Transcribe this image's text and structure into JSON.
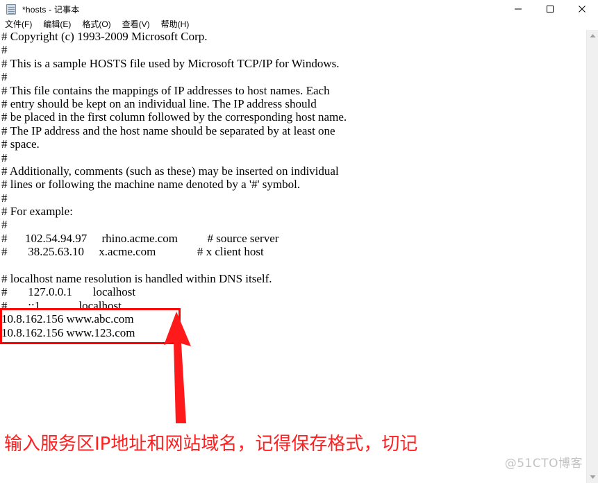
{
  "window": {
    "title": "*hosts - 记事本",
    "icon": "notepad-icon",
    "controls": {
      "minimize": "—",
      "maximize": "□",
      "close": "✕"
    }
  },
  "menubar": {
    "items": [
      {
        "label": "文件(F)",
        "text": "文件",
        "accel": "F"
      },
      {
        "label": "编辑(E)",
        "text": "编辑",
        "accel": "E"
      },
      {
        "label": "格式(O)",
        "text": "格式",
        "accel": "O"
      },
      {
        "label": "查看(V)",
        "text": "查看",
        "accel": "V"
      },
      {
        "label": "帮助(H)",
        "text": "帮助",
        "accel": "H"
      }
    ]
  },
  "editor": {
    "lines": [
      "# Copyright (c) 1993-2009 Microsoft Corp.",
      "#",
      "# This is a sample HOSTS file used by Microsoft TCP/IP for Windows.",
      "#",
      "# This file contains the mappings of IP addresses to host names. Each",
      "# entry should be kept on an individual line. The IP address should",
      "# be placed in the first column followed by the corresponding host name.",
      "# The IP address and the host name should be separated by at least one",
      "# space.",
      "#",
      "# Additionally, comments (such as these) may be inserted on individual",
      "# lines or following the machine name denoted by a '#' symbol.",
      "#",
      "# For example:",
      "#",
      "#      102.54.94.97     rhino.acme.com          # source server",
      "#       38.25.63.10     x.acme.com              # x client host",
      "",
      "# localhost name resolution is handled within DNS itself.",
      "#       127.0.0.1       localhost",
      "#       ::1             localhost",
      "10.8.162.156 www.abc.com",
      "10.8.162.156 www.123.com"
    ]
  },
  "annotations": {
    "highlight_box_label": "new-host-entries-highlight",
    "arrow_label": "callout-arrow",
    "note": "输入服务区IP地址和网站域名，记得保存格式，切记"
  },
  "watermark": {
    "text": "@51CTO博客"
  },
  "colors": {
    "annotation_red": "#fe0000",
    "note_red": "#fe2020",
    "watermark_gray": "#c2c2c2",
    "text_black": "#000000",
    "scrollbar_track": "#f0f0f0"
  },
  "scrollbar": {
    "up_arrow": "▲",
    "down_arrow": "▼"
  }
}
